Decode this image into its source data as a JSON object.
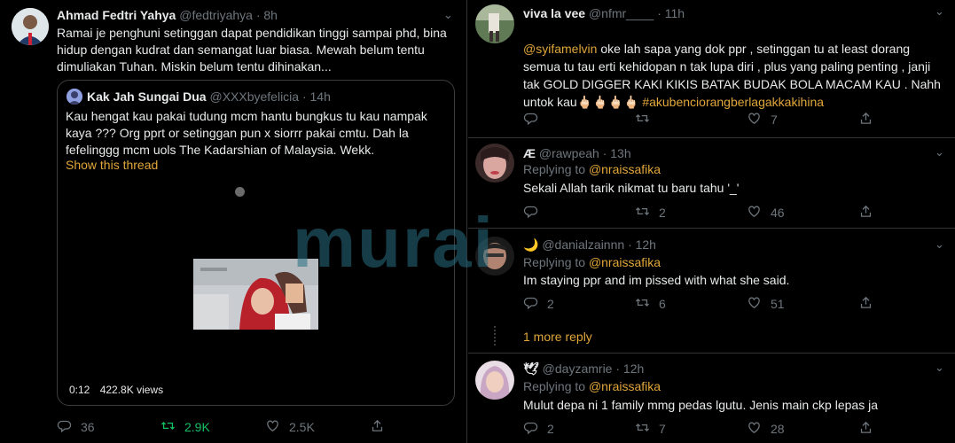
{
  "left_tweet": {
    "author": "Ahmad Fedtri Yahya",
    "handle": "@fedtriyahya",
    "time": "· 8h",
    "text": "Ramai je penghuni setinggan dapat pendidikan tinggi sampai phd, bina hidup dengan kudrat dan semangat luar biasa. Mewah belum tentu dimuliakan Tuhan. Miskin belum tentu dihinakan...",
    "quote": {
      "author": "Kak Jah Sungai Dua",
      "handle": "@XXXbyefelicia",
      "time": "· 14h",
      "text": "Kau hengat kau pakai tudung mcm hantu bungkus tu kau nampak kaya ??? Org pprt or setinggan pun x siorrr pakai cmtu. Dah la fefelinggg mcm uols The Kadarshian of Malaysia. Wekk.",
      "show_thread": "Show this thread",
      "video_time": "0:12",
      "views": "422.8K views"
    },
    "replies": "36",
    "retweets": "2.9K",
    "likes": "2.5K"
  },
  "right_tweets": [
    {
      "author": "viva la vee",
      "handle": "@nfmr____",
      "time": "· 11h",
      "mention": "@syifamelvin",
      "text": " oke lah sapa yang dok ppr , setinggan tu at least dorang semua tu tau erti kehidopan n tak lupa diri , plus yang paling penting , janji tak GOLD DIGGER KAKI KIKIS BATAK BUDAK BOLA MACAM KAU . Nahh untok kau🖕🏻🖕🏻🖕🏻🖕🏻 ",
      "hashtag": "#akubenciorangberlagakkakihina",
      "replies": "",
      "retweets": "",
      "likes": "7"
    },
    {
      "author": "Æ",
      "handle": "@rawpeah",
      "time": "· 13h",
      "replying_prefix": "Replying to ",
      "replying_to": "@nraissafika",
      "text": "Sekali Allah tarik nikmat tu baru tahu '_'",
      "replies": "",
      "retweets": "2",
      "likes": "46"
    },
    {
      "author": "🌙",
      "handle": "@danialzainnn",
      "time": "· 12h",
      "replying_prefix": "Replying to ",
      "replying_to": "@nraissafika",
      "text": "Im staying ppr and im pissed with what she said.",
      "replies": "2",
      "retweets": "6",
      "likes": "51",
      "more_reply": "1 more reply"
    },
    {
      "author": "🕊",
      "handle": "@dayzamrie",
      "time": "· 12h",
      "replying_prefix": "Replying to ",
      "replying_to": "@nraissafika",
      "text": "Mulut depa ni 1 family mmg pedas lgutu. Jenis main ckp lepas ja",
      "replies": "2",
      "retweets": "7",
      "likes": "28"
    }
  ],
  "watermark": "murai",
  "colors": {
    "accent": "#e0a63a",
    "retweet_active": "#17bf63",
    "muted": "#6e767d"
  }
}
